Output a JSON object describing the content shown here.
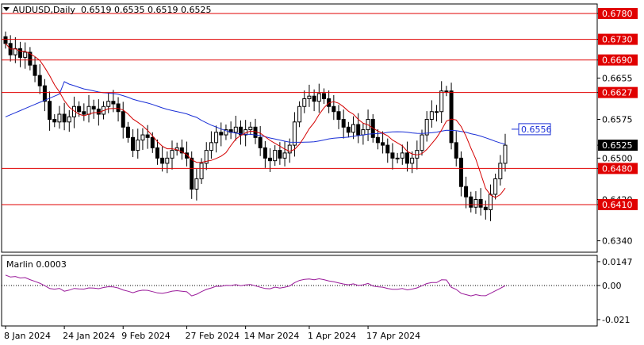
{
  "chart_data": [
    {
      "type": "candlestick",
      "title": "AUDUSD,Daily",
      "ohlc_text": "0.6519 0.6535 0.6519 0.6525",
      "ylim": [
        0.63,
        0.68
      ],
      "y_ticks": [
        "0.6780",
        "0.6730",
        "0.6690",
        "0.6655",
        "0.6627",
        "0.6575",
        "0.6525",
        "0.6500",
        "0.6480",
        "0.6420",
        "0.6410",
        "0.6340"
      ],
      "x_tick_labels": [
        "8 Jan 2024",
        "24 Jan 2024",
        "9 Feb 2024",
        "27 Feb 2024",
        "14 Mar 2024",
        "1 Apr 2024",
        "17 Apr 2024"
      ],
      "levels": [
        0.678,
        0.673,
        0.669,
        0.6627,
        0.648,
        0.641
      ],
      "level_labels": [
        "0.6780",
        "0.6730",
        "0.6690",
        "0.6627",
        "0.6480",
        "0.6410"
      ],
      "current_price": 0.6525,
      "current_price_label": "0.6525",
      "ma_annotation_value": 0.6556,
      "ma_annotation_label": "0.6556",
      "colors": {
        "level": "#e00000",
        "ma_slow": "#1a2fd6",
        "ma_fast": "#d40000",
        "label_bg": "#e00000"
      }
    },
    {
      "type": "line",
      "title": "Marlin 0.0003",
      "y_ticks": [
        "0.0147",
        "0.00",
        "-0.021"
      ],
      "ylim": [
        -0.024,
        0.0165
      ],
      "color": "#9a1a9a"
    }
  ],
  "footer": {
    "x_labels": [
      "8 Jan 2024",
      "24 Jan 2024",
      "9 Feb 2024",
      "27 Feb 2024",
      "14 Mar 2024",
      "1 Apr 2024",
      "17 Apr 2024"
    ]
  }
}
